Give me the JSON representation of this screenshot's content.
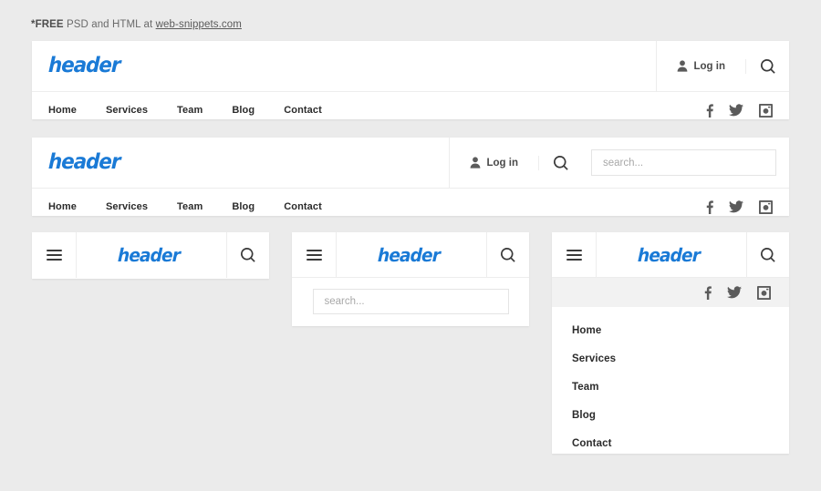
{
  "promo": {
    "bold": "*FREE",
    "middle": " PSD and HTML at ",
    "link": "web-snippets.com"
  },
  "brand": {
    "logo_text": "header",
    "logo_color": "#1a7ad6"
  },
  "labels": {
    "login": "Log in",
    "search_placeholder": "search..."
  },
  "nav": {
    "items": [
      {
        "label": "Home"
      },
      {
        "label": "Services"
      },
      {
        "label": "Team"
      },
      {
        "label": "Blog"
      },
      {
        "label": "Contact"
      }
    ]
  },
  "social": {
    "items": [
      {
        "name": "facebook-icon"
      },
      {
        "name": "twitter-icon"
      },
      {
        "name": "instagram-icon"
      }
    ]
  },
  "icons": {
    "user": "user-icon",
    "search": "search-icon",
    "hamburger": "hamburger-icon"
  },
  "cards": {
    "classic": {
      "name": "header-classic"
    },
    "with_search": {
      "name": "header-with-search"
    },
    "mobile_basic": {
      "name": "header-mobile-basic"
    },
    "mobile_search": {
      "name": "header-mobile-search"
    },
    "mobile_menu": {
      "name": "header-mobile-menu-open"
    }
  },
  "colors": {
    "page_background": "#ebebeb",
    "card_background": "#ffffff",
    "divider": "#ededed",
    "social_bar_background": "#f2f2f2",
    "text_dark": "#2b2b2b",
    "text_muted": "#9a9a9a"
  }
}
